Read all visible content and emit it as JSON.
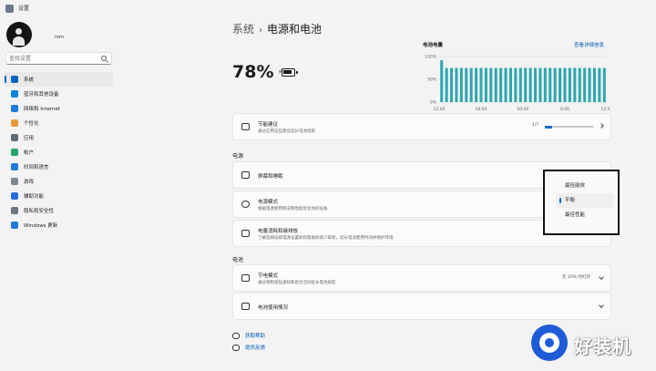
{
  "window": {
    "title": "设置"
  },
  "user": {
    "name": "rom"
  },
  "search": {
    "placeholder": "查找设置"
  },
  "sidebar": {
    "items": [
      {
        "label": "系统",
        "icon": "monitor-icon",
        "color": "#0067c0",
        "selected": true
      },
      {
        "label": "蓝牙和其他设备",
        "icon": "bluetooth-icon",
        "color": "#0a84d8"
      },
      {
        "label": "网络和 Internet",
        "icon": "wifi-icon",
        "color": "#1f7ad9"
      },
      {
        "label": "个性化",
        "icon": "brush-icon",
        "color": "#e59b3c"
      },
      {
        "label": "应用",
        "icon": "apps-icon",
        "color": "#5f6b78"
      },
      {
        "label": "帐户",
        "icon": "account-icon",
        "color": "#24a36b"
      },
      {
        "label": "时间和语言",
        "icon": "globe-icon",
        "color": "#1f7ad9"
      },
      {
        "label": "游戏",
        "icon": "gamepad-icon",
        "color": "#7d8792"
      },
      {
        "label": "辅助功能",
        "icon": "accessibility-icon",
        "color": "#2b6fd6"
      },
      {
        "label": "隐私和安全性",
        "icon": "shield-icon",
        "color": "#6d7784"
      },
      {
        "label": "Windows 更新",
        "icon": "windows-update-icon",
        "color": "#1f7ad9"
      }
    ]
  },
  "header": {
    "parent": "系统",
    "separator": "›",
    "title": "电源和电池"
  },
  "battery": {
    "percent": "78%"
  },
  "usage_chart": {
    "title": "电池电量",
    "link": "查看详细信息",
    "accent": "#2ea6b0"
  },
  "chart_data": {
    "type": "bar",
    "title": "电池电量",
    "y_ticks": [
      "100%",
      "50%",
      "0%"
    ],
    "ylim": [
      0,
      100
    ],
    "x_ticks": [
      "12:00",
      "18:00",
      "00:00",
      "6:00",
      "12:00"
    ],
    "values": [
      92,
      75,
      75,
      75,
      75,
      75,
      75,
      75,
      75,
      75,
      75,
      75,
      75,
      75,
      75,
      75,
      75,
      75,
      75,
      75,
      75,
      75,
      75,
      75,
      75,
      75,
      75,
      75,
      75,
      75,
      75,
      75,
      75,
      75
    ],
    "bar_color": "#2ea6b0"
  },
  "recommendations": {
    "title": "节能建议",
    "desc": "通过应用这些建议延长电池续航",
    "progress_text": "1/7",
    "progress": 0.14
  },
  "power_section": {
    "heading": "电源",
    "screen_sleep": {
      "title": "屏幕和睡眠"
    },
    "power_mode": {
      "title": "电源模式",
      "desc": "根据电源使用情况和性能优化你的设备"
    },
    "power_usage": {
      "title": "电量消耗和碳排放",
      "desc": "了解选择低碳电源设置如何帮助你减少碳耗，延长电池使用时间并保护环境"
    }
  },
  "power_mode_menu": {
    "options": [
      "最佳能效",
      "平衡",
      "最佳性能"
    ],
    "selected": "平衡"
  },
  "battery_section": {
    "heading": "电池",
    "saver": {
      "title": "节电模式",
      "desc": "通过限制某些通知和后台活动延长电池续航",
      "value": "在 20% 时打开"
    },
    "usage": {
      "title": "电池使用情况"
    }
  },
  "footer": {
    "help": "获取帮助",
    "feedback": "提供反馈"
  },
  "watermark": {
    "text": "好装机"
  }
}
